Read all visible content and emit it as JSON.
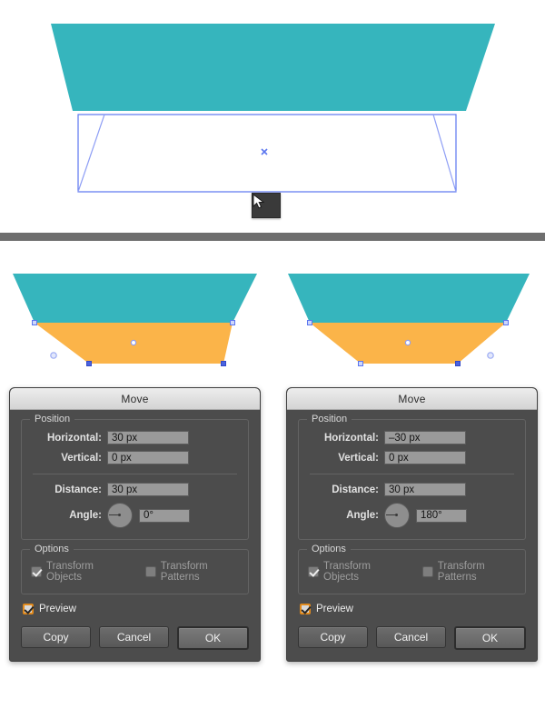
{
  "canvas": {
    "background": "#ffffff",
    "teal_color": "#36b5bd",
    "orange_color": "#fbb449",
    "selection_color": "#5b76ef",
    "divider_color": "#6e6e6e"
  },
  "top_panel": {
    "name": "artboard-top",
    "teal_shape_label": "teal-trapezoid",
    "selection_label": "selection-bounding-box",
    "center_anchor_label": "center-anchor-point",
    "cursor_label": "arrow-cursor"
  },
  "illustrations": [
    {
      "name": "illustration-left",
      "teal_label": "teal-trapezoid",
      "orange_label": "orange-quadrilateral"
    },
    {
      "name": "illustration-right",
      "teal_label": "teal-trapezoid",
      "orange_label": "orange-quadrilateral"
    }
  ],
  "dialogs": [
    {
      "id": "left",
      "title": "Move",
      "position_group": {
        "legend": "Position",
        "horizontal_label": "Horizontal:",
        "horizontal_value": "30 px",
        "vertical_label": "Vertical:",
        "vertical_value": "0 px",
        "distance_label": "Distance:",
        "distance_value": "30 px",
        "angle_label": "Angle:",
        "angle_value": "0°"
      },
      "options_group": {
        "legend": "Options",
        "transform_objects_label": "Transform Objects",
        "transform_objects_checked": true,
        "transform_patterns_label": "Transform Patterns",
        "transform_patterns_checked": false
      },
      "preview_label": "Preview",
      "preview_checked": true,
      "buttons": {
        "copy": "Copy",
        "cancel": "Cancel",
        "ok": "OK"
      }
    },
    {
      "id": "right",
      "title": "Move",
      "position_group": {
        "legend": "Position",
        "horizontal_label": "Horizontal:",
        "horizontal_value": "–30 px",
        "vertical_label": "Vertical:",
        "vertical_value": "0 px",
        "distance_label": "Distance:",
        "distance_value": "30 px",
        "angle_label": "Angle:",
        "angle_value": "180°"
      },
      "options_group": {
        "legend": "Options",
        "transform_objects_label": "Transform Objects",
        "transform_objects_checked": true,
        "transform_patterns_label": "Transform Patterns",
        "transform_patterns_checked": false
      },
      "preview_label": "Preview",
      "preview_checked": true,
      "buttons": {
        "copy": "Copy",
        "cancel": "Cancel",
        "ok": "OK"
      }
    }
  ]
}
